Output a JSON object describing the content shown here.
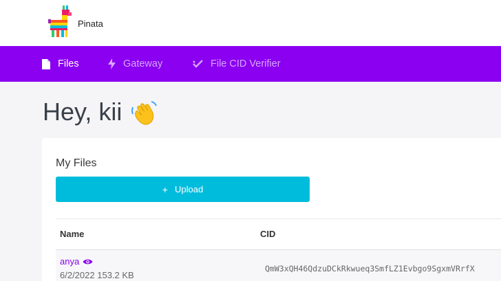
{
  "header": {
    "brand": "Pinata"
  },
  "nav": {
    "items": [
      {
        "label": "Files",
        "active": true,
        "icon": "file-icon"
      },
      {
        "label": "Gateway",
        "active": false,
        "icon": "lightning-icon"
      },
      {
        "label": "File CID Verifier",
        "active": false,
        "icon": "double-check-icon"
      }
    ]
  },
  "greeting": "Hey, kii",
  "files": {
    "title": "My Files",
    "upload_label": "Upload",
    "columns": {
      "name": "Name",
      "cid": "CID"
    },
    "rows": [
      {
        "name": "anya",
        "date": "6/2/2022",
        "size": "153.2 KB",
        "cid": "QmW3xQH46QdzuDCkRkwueq3SmfLZ1Evbgo9SgxmVRrfX"
      }
    ]
  },
  "colors": {
    "nav_bg": "#8b00f0",
    "nav_active": "#ffffff",
    "nav_inactive": "#d6a6ff",
    "upload_bg": "#00bcdc",
    "link": "#8b00f0"
  }
}
